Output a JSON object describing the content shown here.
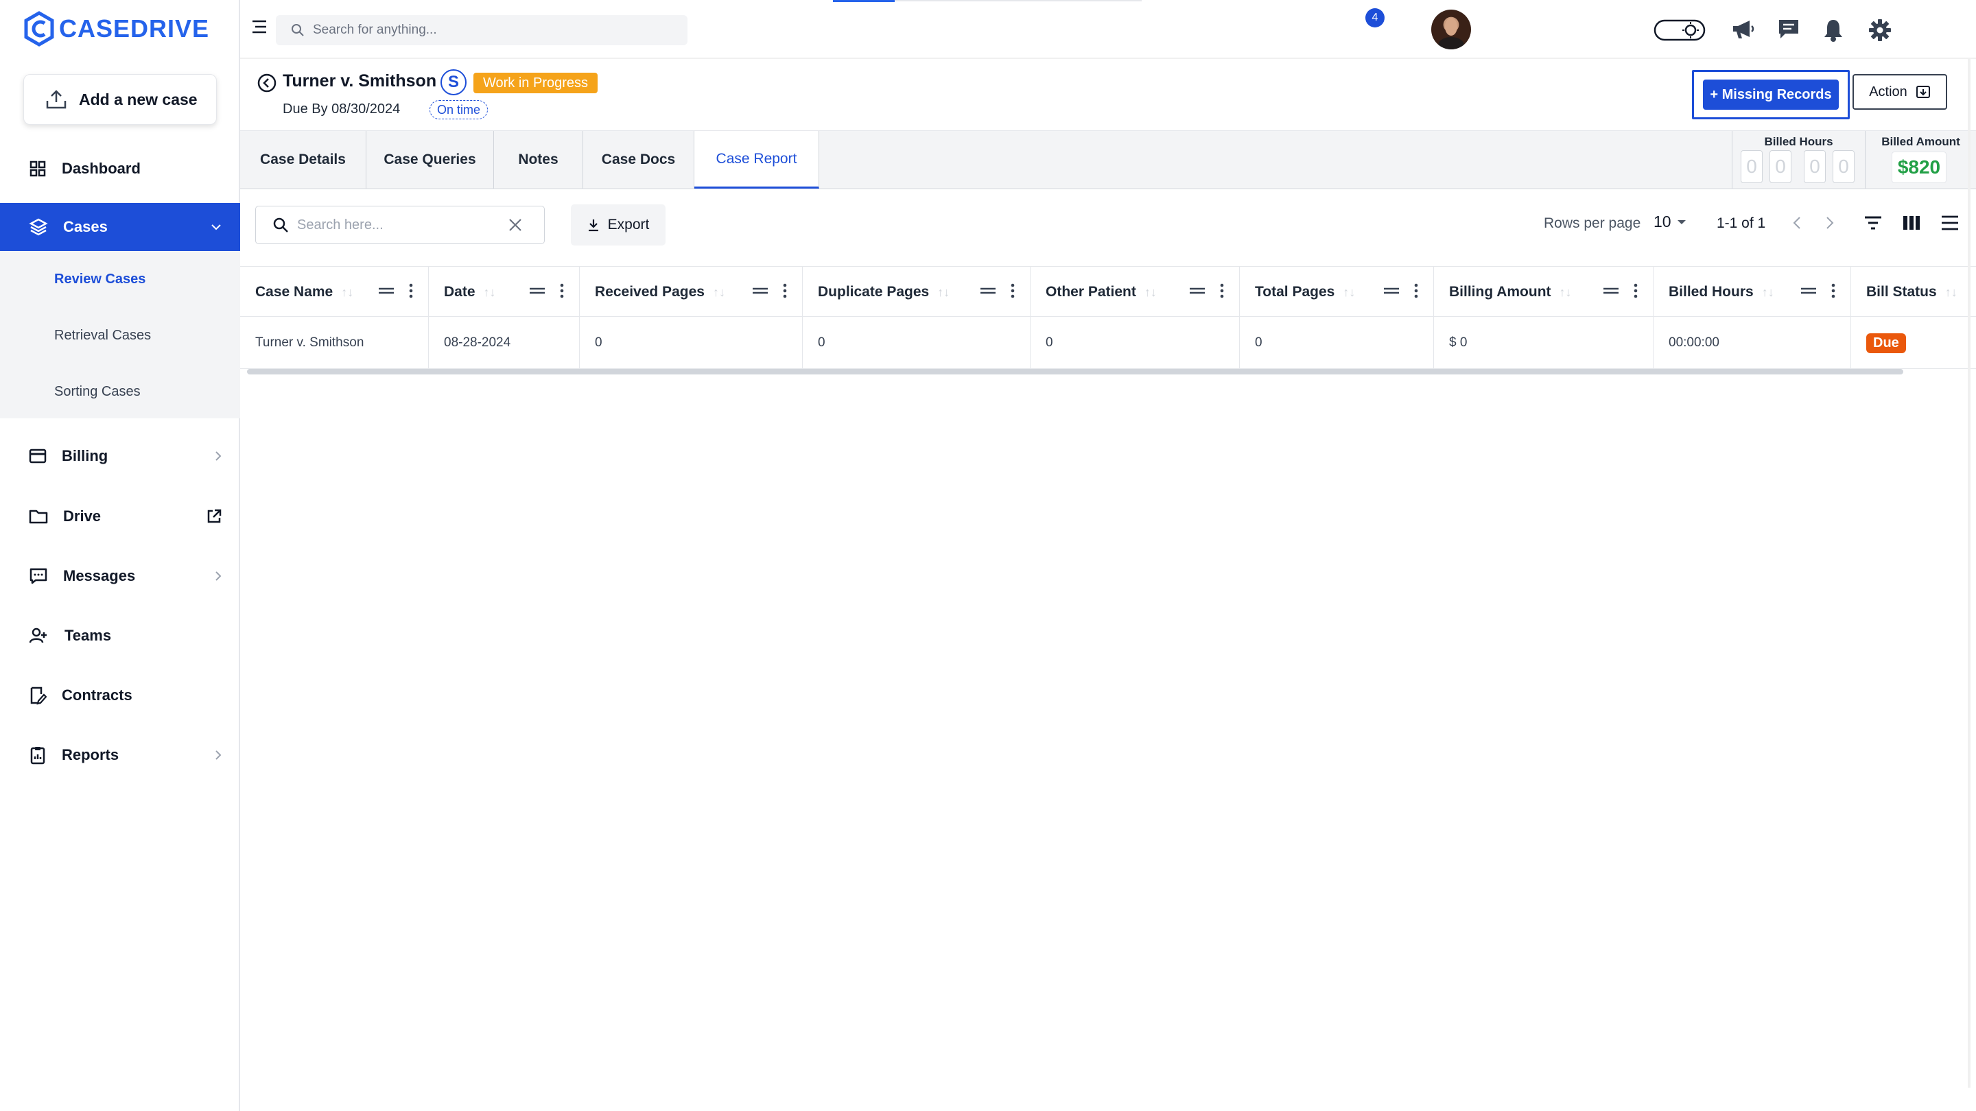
{
  "brand": {
    "name": "CASEDRIVE",
    "color": "#2563eb"
  },
  "sidebar": {
    "add_case_label": "Add a new case",
    "items": [
      {
        "label": "Dashboard",
        "icon": "dashboard-icon"
      },
      {
        "label": "Cases",
        "icon": "layers-icon",
        "active": true
      },
      {
        "label": "Billing",
        "icon": "credit-card-icon"
      },
      {
        "label": "Drive",
        "icon": "folder-icon"
      },
      {
        "label": "Messages",
        "icon": "message-icon"
      },
      {
        "label": "Teams",
        "icon": "users-icon"
      },
      {
        "label": "Contracts",
        "icon": "contract-icon"
      },
      {
        "label": "Reports",
        "icon": "clipboard-icon"
      }
    ],
    "sub_items": [
      {
        "label": "Review Cases",
        "active": true
      },
      {
        "label": "Retrieval Cases"
      },
      {
        "label": "Sorting Cases"
      }
    ]
  },
  "topbar": {
    "search_placeholder": "Search for anything...",
    "notification_count": "4"
  },
  "case": {
    "title": "Turner v. Smithson",
    "initial": "S",
    "status": "Work in Progress",
    "due": "Due By 08/30/2024",
    "timeliness": "On time",
    "missing_records_label": "+ Missing Records",
    "action_label": "Action"
  },
  "tabs": [
    {
      "label": "Case Details"
    },
    {
      "label": "Case Queries"
    },
    {
      "label": "Notes"
    },
    {
      "label": "Case Docs"
    },
    {
      "label": "Case Report",
      "active": true
    }
  ],
  "billing": {
    "hours_label": "Billed Hours",
    "hours_digits": [
      "0",
      "0",
      "0",
      "0"
    ],
    "amount_label": "Billed Amount",
    "amount": "$820"
  },
  "toolbar": {
    "search_placeholder": "Search here...",
    "export_label": "Export",
    "rows_per_page_label": "Rows per page",
    "rows_per_page": "10",
    "page_info": "1-1 of 1"
  },
  "table": {
    "columns": [
      "Case Name",
      "Date",
      "Received Pages",
      "Duplicate Pages",
      "Other Patient",
      "Total Pages",
      "Billing Amount",
      "Billed Hours",
      "Bill Status"
    ],
    "rows": [
      [
        "Turner v. Smithson",
        "08-28-2024",
        "0",
        "0",
        "0",
        "0",
        "$ 0",
        "00:00:00",
        "Due"
      ]
    ]
  },
  "colors": {
    "accent": "#1d4ed8",
    "status_wip": "#f5a31a",
    "due": "#ea580c",
    "amount": "#22a046"
  }
}
